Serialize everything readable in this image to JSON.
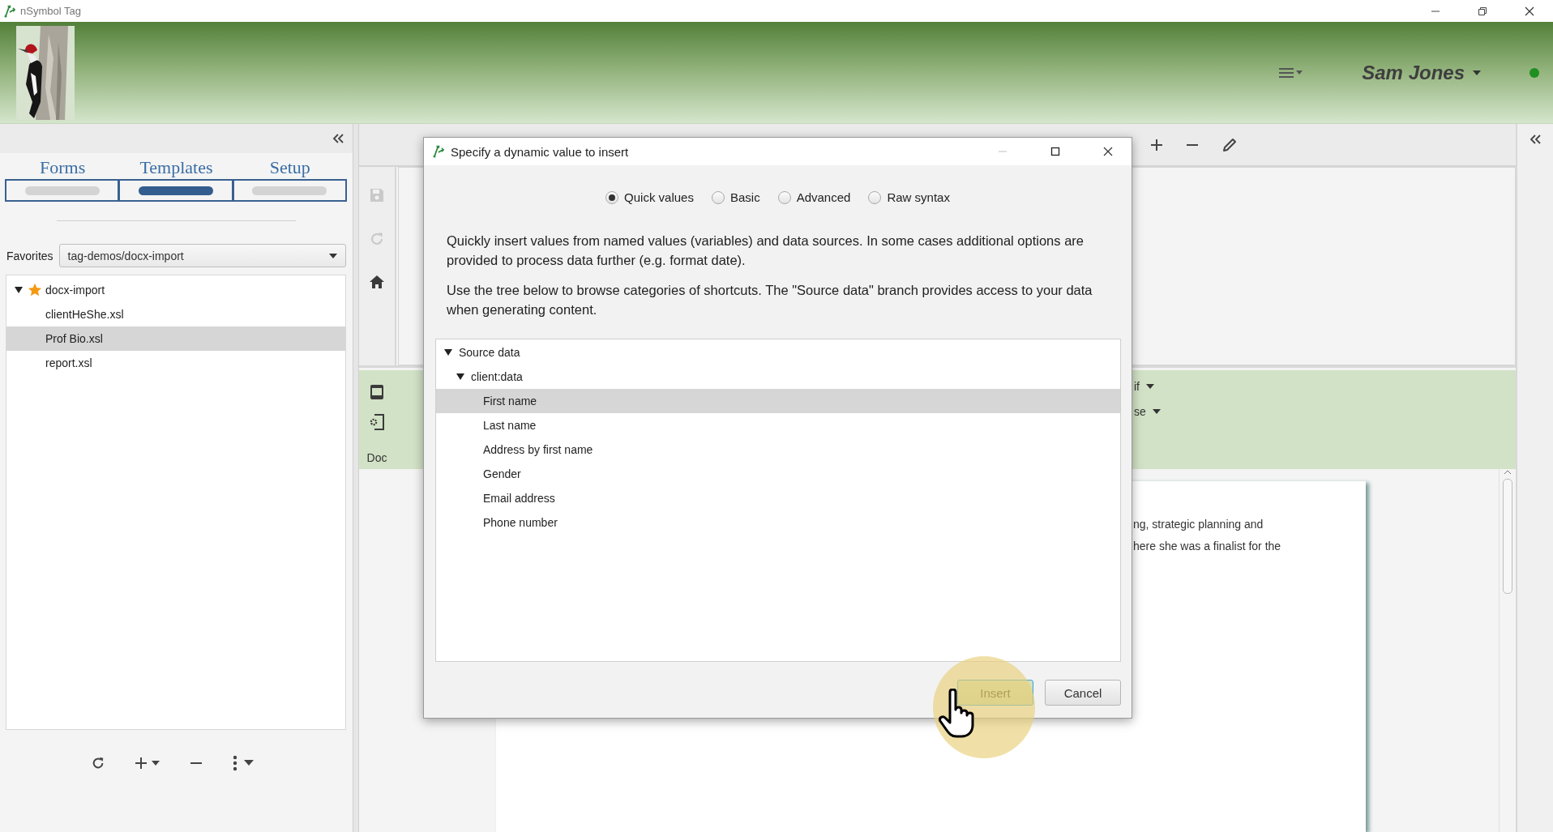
{
  "window": {
    "title": "nSymbol Tag"
  },
  "header": {
    "user": "Sam Jones",
    "online": true
  },
  "sidebar": {
    "tabs": [
      {
        "label": "Forms",
        "selected": false
      },
      {
        "label": "Templates",
        "selected": true
      },
      {
        "label": "Setup",
        "selected": false
      }
    ],
    "favorites": {
      "label": "Favorites",
      "value": "tag-demos/docx-import"
    },
    "tree": [
      {
        "label": "docx-import",
        "starred": true,
        "expanded": true,
        "selected": false,
        "children": [
          {
            "label": "clientHeShe.xsl",
            "selected": false
          },
          {
            "label": "Prof Bio.xsl",
            "selected": true
          },
          {
            "label": "report.xsl",
            "selected": false
          }
        ]
      }
    ]
  },
  "workspace": {
    "ribbon": {
      "label": "Doc",
      "menus": [
        "if",
        "se"
      ]
    },
    "document_lines": [
      "ng, strategic planning and",
      "here she was a finalist for the"
    ]
  },
  "dialog": {
    "title": "Specify a dynamic value to insert",
    "modes": [
      {
        "label": "Quick values",
        "selected": true
      },
      {
        "label": "Basic",
        "selected": false
      },
      {
        "label": "Advanced",
        "selected": false
      },
      {
        "label": "Raw syntax",
        "selected": false
      }
    ],
    "paragraphs": [
      "Quickly insert values from named values (variables) and data sources. In some cases additional options are provided to process data further (e.g. format date).",
      "Use the tree below to browse categories of shortcuts. The \"Source data\" branch provides access to your data when generating content."
    ],
    "tree": [
      {
        "label": "Source data",
        "expanded": true,
        "selected": false,
        "children": [
          {
            "label": "client:data",
            "expanded": true,
            "selected": false,
            "children": [
              {
                "label": "First name",
                "selected": true
              },
              {
                "label": "Last name",
                "selected": false
              },
              {
                "label": "Address by first name",
                "selected": false
              },
              {
                "label": "Gender",
                "selected": false
              },
              {
                "label": "Email address",
                "selected": false
              },
              {
                "label": "Phone number",
                "selected": false
              }
            ]
          }
        ]
      }
    ],
    "buttons": [
      {
        "label": "Insert",
        "kind": "primary"
      },
      {
        "label": "Cancel",
        "kind": "default"
      }
    ]
  }
}
